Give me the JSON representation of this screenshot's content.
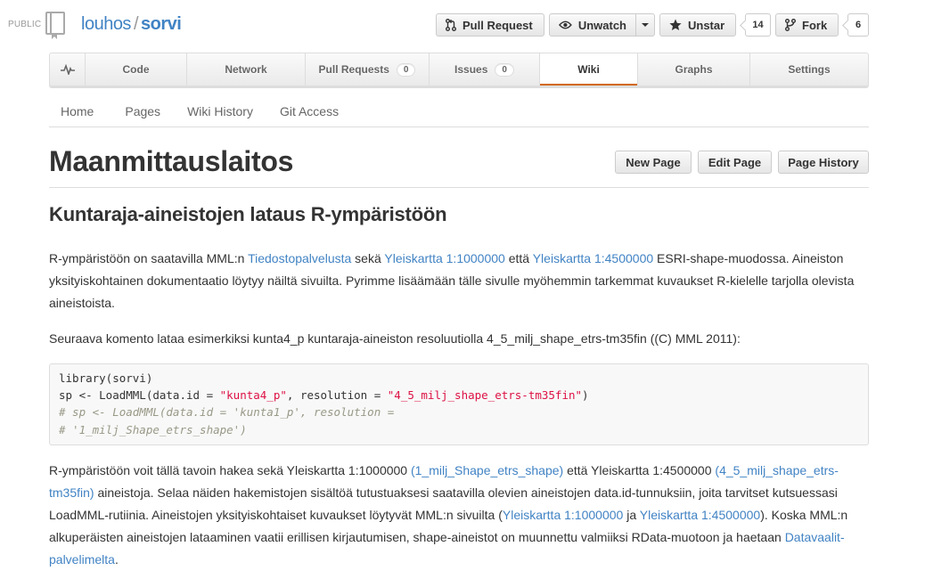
{
  "repo": {
    "visibility": "PUBLIC",
    "owner": "louhos",
    "separator": "/",
    "name": "sorvi"
  },
  "actions": {
    "pull_request": "Pull Request",
    "unwatch": "Unwatch",
    "unstar": "Unstar",
    "star_count": "14",
    "fork": "Fork",
    "fork_count": "6"
  },
  "tabs": [
    {
      "label": "",
      "icon": "pulse-icon"
    },
    {
      "label": "Code"
    },
    {
      "label": "Network"
    },
    {
      "label": "Pull Requests",
      "count": "0"
    },
    {
      "label": "Issues",
      "count": "0"
    },
    {
      "label": "Wiki",
      "selected": true
    },
    {
      "label": "Graphs"
    },
    {
      "label": "Settings"
    }
  ],
  "wiki_nav": {
    "home": "Home",
    "pages": "Pages",
    "history": "Wiki History",
    "git_access": "Git Access"
  },
  "page": {
    "title": "Maanmittauslaitos",
    "new_page": "New Page",
    "edit_page": "Edit Page",
    "page_history": "Page History"
  },
  "article": {
    "heading": "Kuntaraja-aineistojen lataus R-ympäristöön",
    "p1": {
      "t1": "R-ympäristöön on saatavilla MML:n ",
      "l1": "Tiedostopalvelusta",
      "t2": " sekä ",
      "l2": "Yleiskartta 1:1000000",
      "t3": " että ",
      "l3": "Yleiskartta 1:4500000",
      "t4": " ESRI-shape-muodossa. Aineiston yksityiskohtainen dokumentaatio löytyy näiltä sivuilta. Pyrimme lisäämään tälle sivulle myöhemmin tarkemmat kuvaukset R-kielelle tarjolla olevista aineistoista."
    },
    "p2": "Seuraava komento lataa esimerkiksi kunta4_p kuntaraja-aineiston resoluutiolla 4_5_milj_shape_etrs-tm35fin ((C) MML 2011):",
    "code": {
      "line1": "library(sorvi)",
      "line2_a": "sp <- LoadMML(data.id = ",
      "line2_s1": "\"kunta4_p\"",
      "line2_b": ", resolution = ",
      "line2_s2": "\"4_5_milj_shape_etrs-tm35fin\"",
      "line2_c": ")",
      "line3": "# sp <- LoadMML(data.id = 'kunta1_p', resolution =",
      "line4": "# '1_milj_Shape_etrs_shape')"
    },
    "p3": {
      "t1": "R-ympäristöön voit tällä tavoin hakea sekä Yleiskartta 1:1000000 ",
      "l1": "(1_milj_Shape_etrs_shape)",
      "t2": " että Yleiskartta 1:4500000 ",
      "l2": "(4_5_milj_shape_etrs-tm35fin)",
      "t3": " aineistoja. Selaa näiden hakemistojen sisältöä tutustuaksesi saatavilla olevien aineistojen data.id-tunnuksiin, joita tarvitset kutsuessasi LoadMML-rutiinia. Aineistojen yksityiskohtaiset kuvaukset löytyvät MML:n sivuilta (",
      "l3": "Yleiskartta 1:1000000",
      "t4": " ja ",
      "l4": "Yleiskartta 1:4500000",
      "t5": "). Koska MML:n alkuperäisten aineistojen lataaminen vaatii erillisen kirjautumisen, shape-aineistot on muunnettu valmiiksi RData-muotoon ja haetaan ",
      "l5": "Datavaalit-palvelimelta",
      "t6": "."
    }
  },
  "colors": {
    "link": "#4183c4",
    "selected_tab_accent": "#d26911",
    "code_string": "#dd1144",
    "code_comment": "#999988"
  }
}
